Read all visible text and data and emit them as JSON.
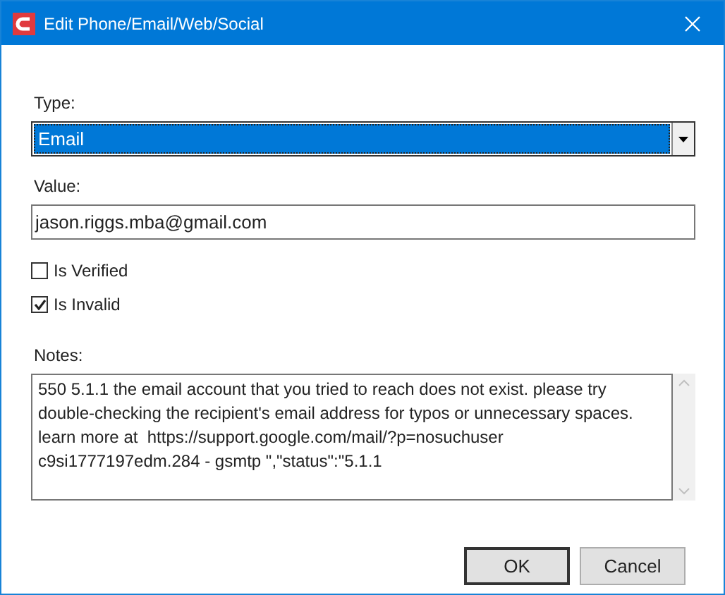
{
  "window": {
    "title": "Edit Phone/Email/Web/Social"
  },
  "type_field": {
    "label": "Type:",
    "value": "Email"
  },
  "value_field": {
    "label": "Value:",
    "value": "jason.riggs.mba@gmail.com"
  },
  "checkboxes": [
    {
      "label": "Is Verified",
      "checked": false
    },
    {
      "label": "Is Invalid",
      "checked": true
    }
  ],
  "notes": {
    "label": "Notes:",
    "value": "550 5.1.1 the email account that you tried to reach does not exist. please try double-checking the recipient's email address for typos or unnecessary spaces. learn more at  https://support.google.com/mail/?p=nosuchuser c9si1777197edm.284 - gsmtp \",\"status\":\"5.1.1"
  },
  "buttons": [
    {
      "label": "OK",
      "default": true
    },
    {
      "label": "Cancel",
      "default": false
    }
  ]
}
